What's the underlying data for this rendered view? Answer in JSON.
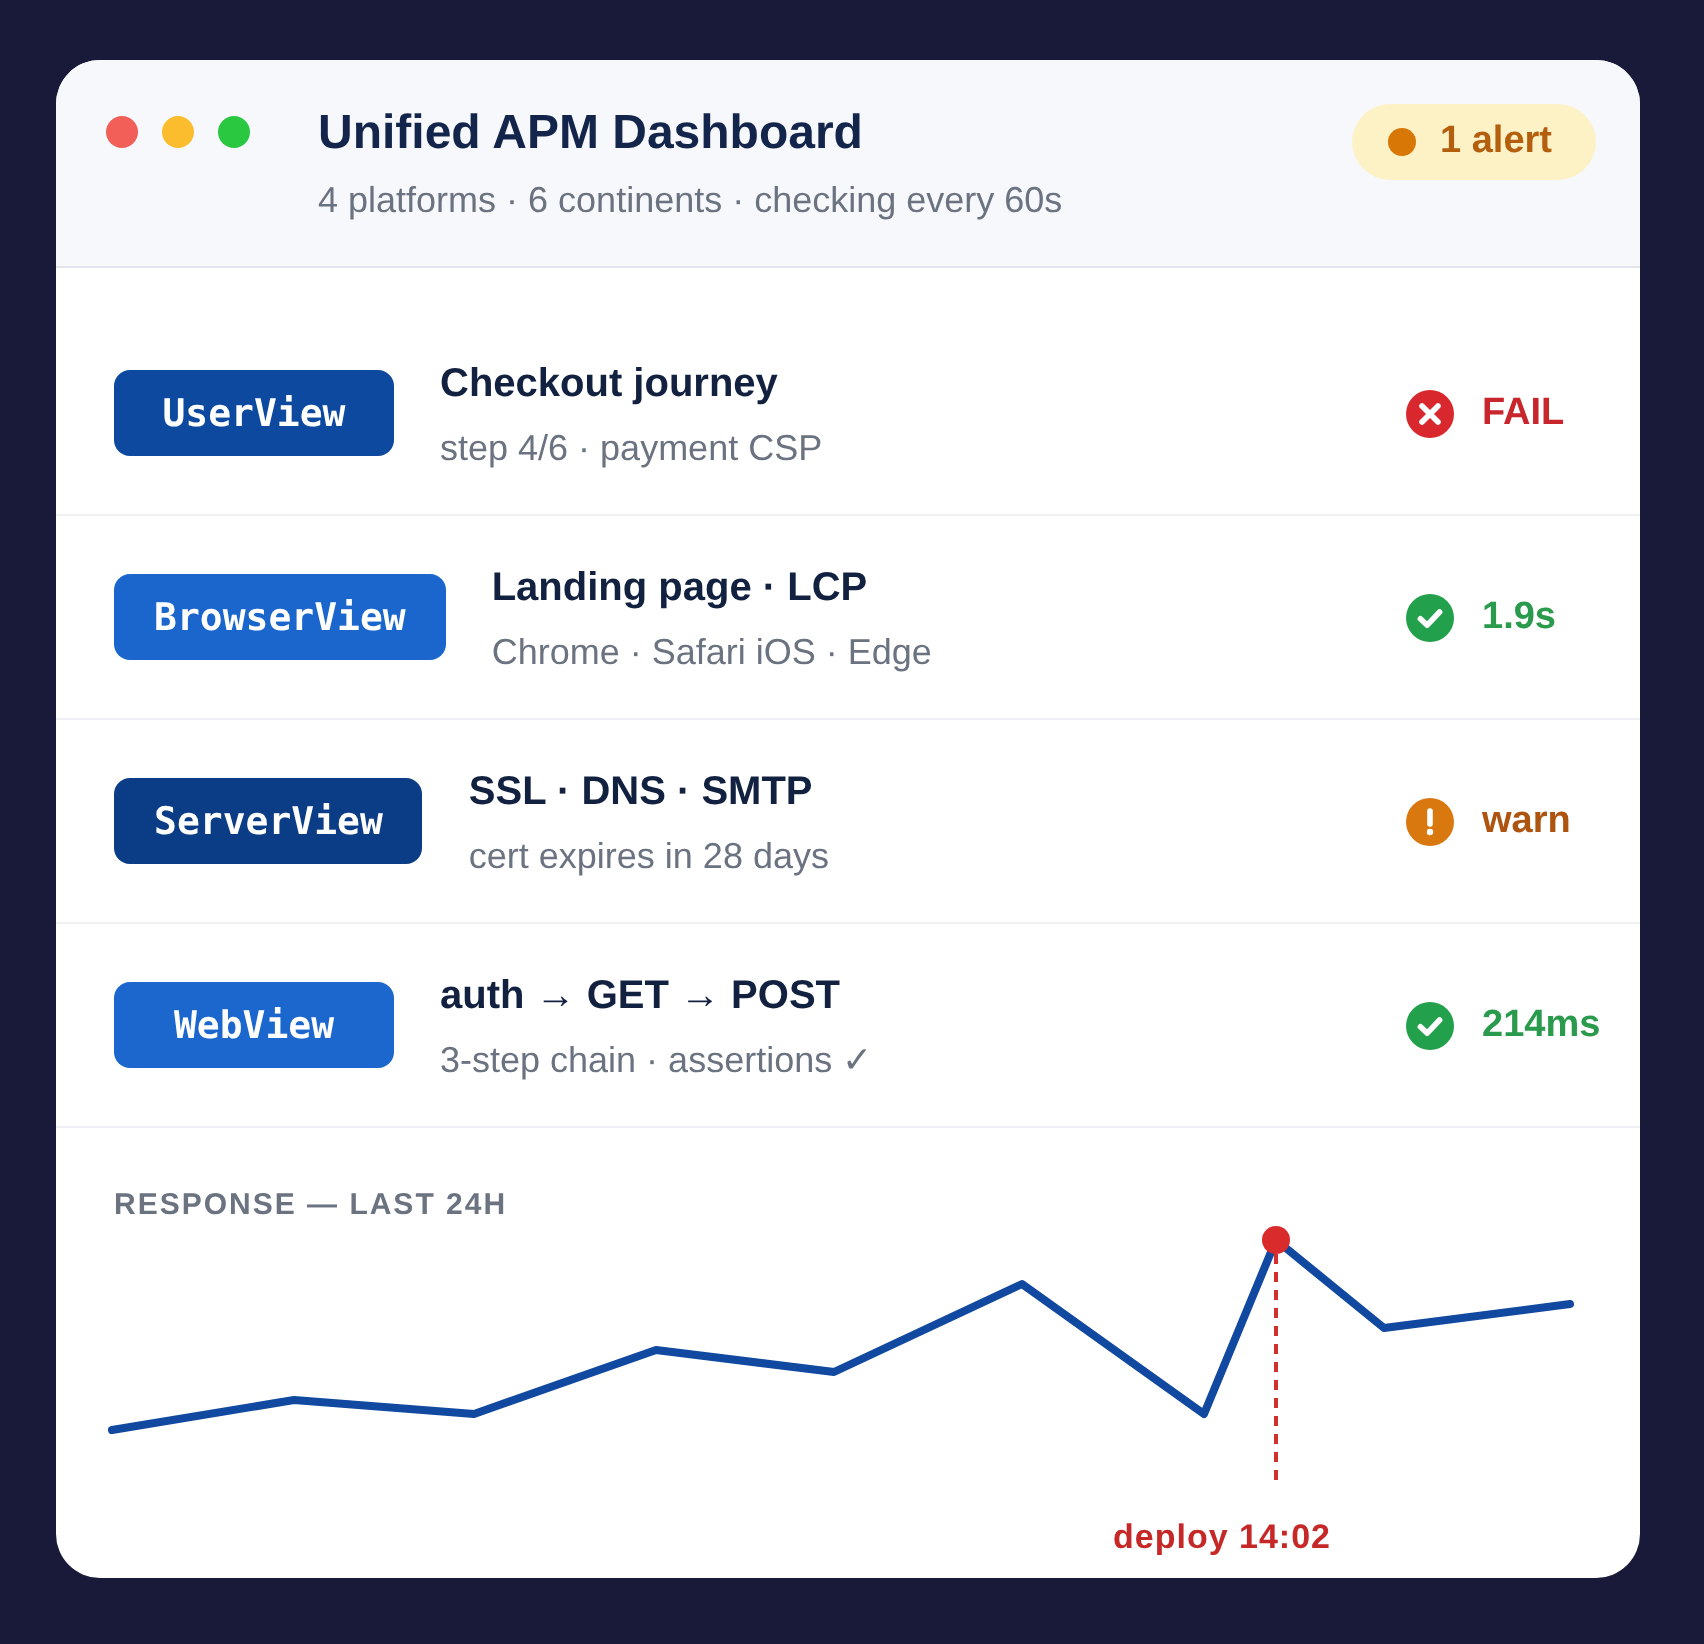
{
  "window": {
    "title": "Unified APM Dashboard",
    "subtitle": "4 platforms · 6 continents · checking every 60s"
  },
  "alert": {
    "label": "1 alert"
  },
  "rows": [
    {
      "tag": "UserView",
      "color": "#0d4a9f",
      "title": "Checkout journey",
      "detail": "step 4/6 · payment CSP",
      "status": {
        "kind": "fail",
        "value": "FAIL"
      }
    },
    {
      "tag": "BrowserView",
      "color": "#1a66cc",
      "title": "Landing page · LCP",
      "detail": "Chrome · Safari iOS · Edge",
      "status": {
        "kind": "ok",
        "value": "1.9s"
      }
    },
    {
      "tag": "ServerView",
      "color": "#0b3c86",
      "title": "SSL · DNS · SMTP",
      "detail": "cert expires in 28 days",
      "status": {
        "kind": "warn",
        "value": "warn"
      }
    },
    {
      "tag": "WebView",
      "color": "#1b67cd",
      "title": "auth → GET → POST",
      "detail": "3-step chain · assertions ✓",
      "status": {
        "kind": "ok",
        "value": "214ms"
      }
    }
  ],
  "chart": {
    "title": "RESPONSE — LAST 24H",
    "annotation": "deploy 14:02"
  }
}
